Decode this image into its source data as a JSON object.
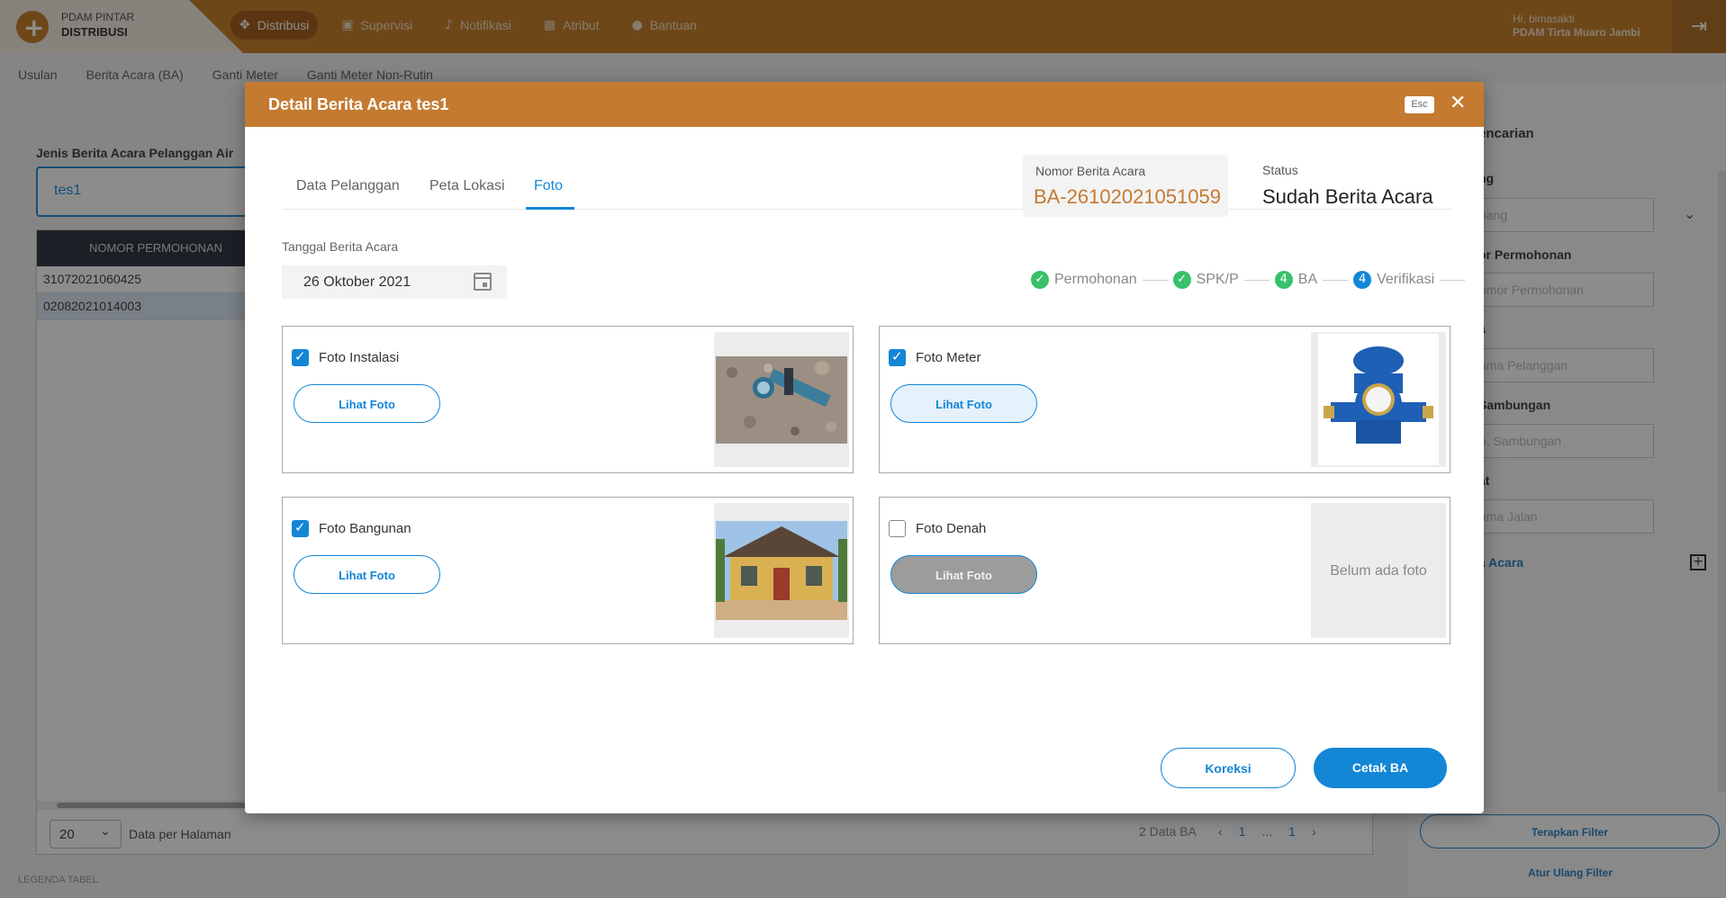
{
  "header": {
    "brand_line1": "PDAM PINTAR",
    "brand_line2": "DISTRIBUSI",
    "nav": [
      {
        "label": "Distribusi",
        "icon": "move-icon",
        "active": true
      },
      {
        "label": "Supervisi",
        "icon": "briefcase-icon",
        "active": false
      },
      {
        "label": "Notifikasi",
        "icon": "bell-icon",
        "active": false
      },
      {
        "label": "Atribut",
        "icon": "table-icon",
        "active": false
      },
      {
        "label": "Bantuan",
        "icon": "chat-icon",
        "active": false
      }
    ],
    "user_greeting": "Hi, bimasakti",
    "user_org": "PDAM Tirta Muaro Jambi"
  },
  "subnav": [
    "Usulan",
    "Berita Acara (BA)",
    "Ganti Meter",
    "Ganti Meter Non-Rutin"
  ],
  "background": {
    "filter_label": "Jenis Berita Acara Pelanggan Air",
    "filter_value": "tes1",
    "table_header": "NOMOR PERMOHONAN",
    "rows": [
      "31072021060425",
      "02082021014003"
    ],
    "page_size": "20",
    "per_page_label": "Data per Halaman",
    "count_label": "2 Data BA",
    "pager": [
      "‹",
      "1",
      "...",
      "1",
      "›"
    ],
    "legend": "LEGENDA TABEL"
  },
  "side": {
    "title": "encarian",
    "labels": [
      "ng",
      "or Permohonan",
      "a",
      "Sambungan",
      "at"
    ],
    "placeholders": [
      "bang",
      "omor Permohonan",
      "ama Pelanggan",
      "o. Sambungan",
      "ama Jalan"
    ],
    "link": "a Acara",
    "apply": "Terapkan Filter",
    "reset": "Atur Ulang Filter"
  },
  "modal": {
    "title": "Detail Berita Acara tes1",
    "esc": "Esc",
    "tabs": [
      "Data Pelanggan",
      "Peta Lokasi",
      "Foto"
    ],
    "active_tab": "Foto",
    "nomor_label": "Nomor Berita Acara",
    "nomor_value": "BA-26102021051059",
    "status_label": "Status",
    "status_value": "Sudah Berita Acara",
    "tanggal_label": "Tanggal Berita Acara",
    "tanggal_value": "26 Oktober 2021",
    "steps": [
      {
        "label": "Permohonan",
        "mark": "✓",
        "state": "done"
      },
      {
        "label": "SPK/P",
        "mark": "✓",
        "state": "done"
      },
      {
        "label": "BA",
        "mark": "4",
        "state": "done"
      },
      {
        "label": "Verifikasi",
        "mark": "4",
        "state": "current"
      }
    ],
    "photos": [
      {
        "label": "Foto Instalasi",
        "checked": true,
        "button": "Lihat Foto",
        "photo": "water-meter-in-gravel-photo"
      },
      {
        "label": "Foto Meter",
        "checked": true,
        "button": "Lihat Foto",
        "photo": "blue-water-meter-photo"
      },
      {
        "label": "Foto Bangunan",
        "checked": true,
        "button": "Lihat Foto",
        "photo": "house-photo"
      },
      {
        "label": "Foto Denah",
        "checked": false,
        "button": "Lihat Foto",
        "empty_text": "Belum ada foto"
      }
    ],
    "btn_koreksi": "Koreksi",
    "btn_cetak": "Cetak BA",
    "colors": {
      "accent": "#c47a30",
      "primary": "#1386d6",
      "success": "#38c06b"
    }
  }
}
